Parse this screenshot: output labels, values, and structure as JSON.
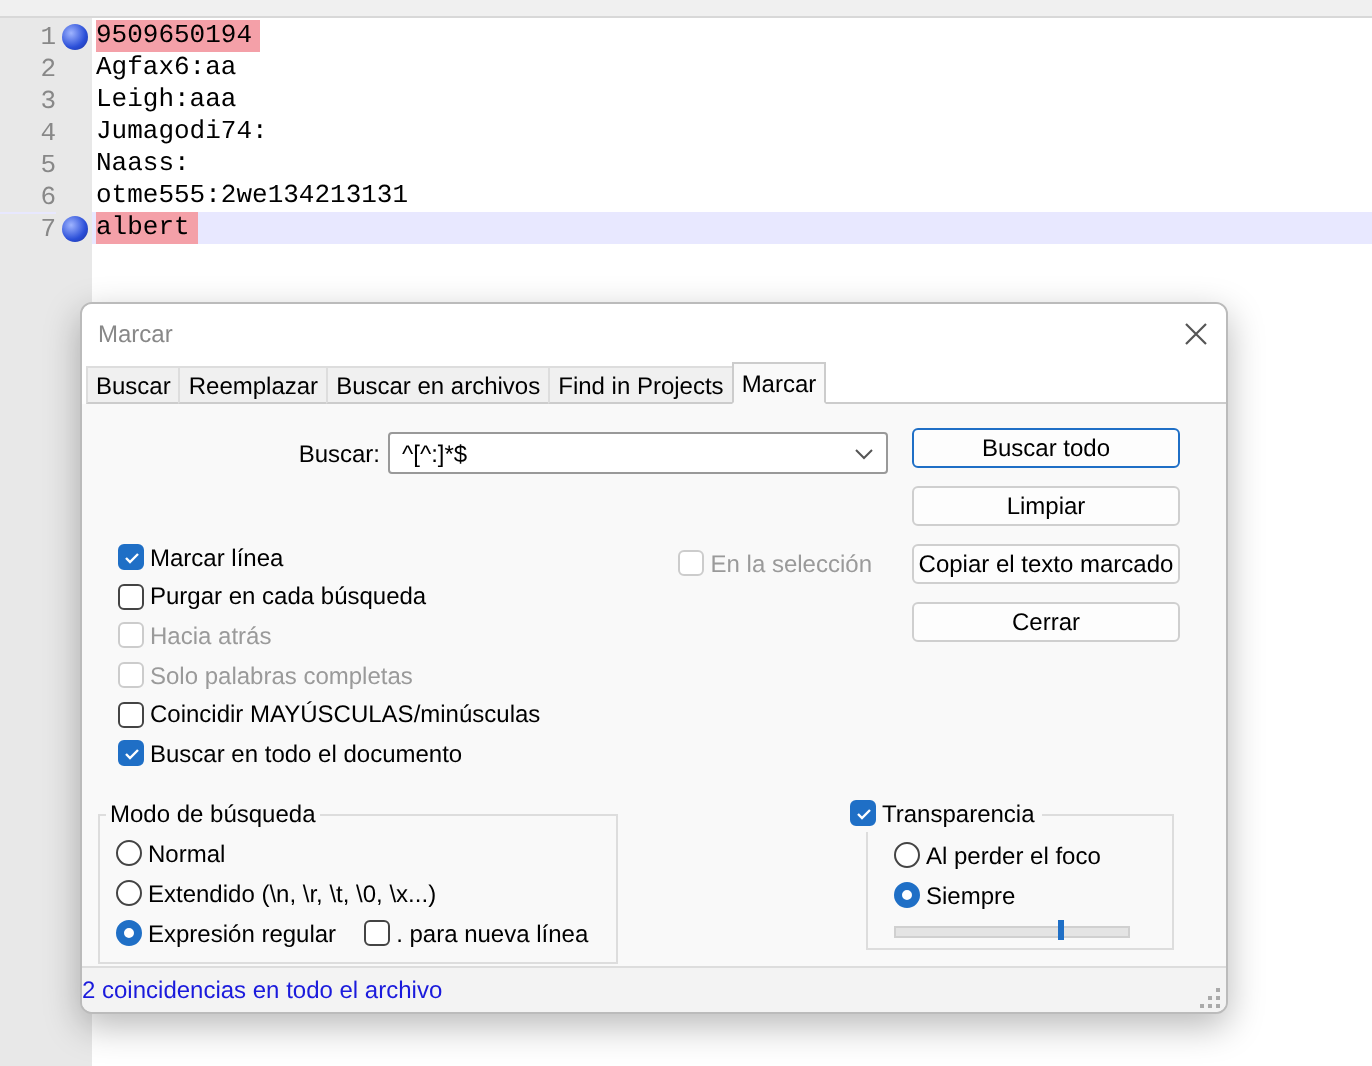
{
  "editor": {
    "lines": [
      {
        "number": "1",
        "text": "9509650194",
        "bookmark": true,
        "marked": true,
        "current": false
      },
      {
        "number": "2",
        "text": "Agfax6:aa",
        "bookmark": false,
        "marked": false,
        "current": false
      },
      {
        "number": "3",
        "text": "Leigh:aaa",
        "bookmark": false,
        "marked": false,
        "current": false
      },
      {
        "number": "4",
        "text": "Jumagodi74:",
        "bookmark": false,
        "marked": false,
        "current": false
      },
      {
        "number": "5",
        "text": "Naass:",
        "bookmark": false,
        "marked": false,
        "current": false
      },
      {
        "number": "6",
        "text": "otme555:2we134213131",
        "bookmark": false,
        "marked": false,
        "current": false
      },
      {
        "number": "7",
        "text": "albert",
        "bookmark": true,
        "marked": true,
        "current": true
      }
    ]
  },
  "dialog": {
    "title": "Marcar",
    "tabs": [
      {
        "label": "Buscar",
        "selected": false
      },
      {
        "label": "Reemplazar",
        "selected": false
      },
      {
        "label": "Buscar en archivos",
        "selected": false
      },
      {
        "label": "Find in Projects",
        "selected": false
      },
      {
        "label": "Marcar",
        "selected": true
      }
    ],
    "search": {
      "label": "Buscar:",
      "value": "^[^:]*$"
    },
    "options": [
      {
        "label": "Marcar línea",
        "checked": true,
        "disabled": false
      },
      {
        "label": "Purgar en cada búsqueda",
        "checked": false,
        "disabled": false
      },
      {
        "label": "Hacia atrás",
        "checked": false,
        "disabled": true
      },
      {
        "label": "Solo palabras completas",
        "checked": false,
        "disabled": true
      },
      {
        "label": "Coincidir MAYÚSCULAS/minúsculas",
        "checked": false,
        "disabled": false
      },
      {
        "label": "Buscar en todo el documento",
        "checked": true,
        "disabled": false
      }
    ],
    "in_selection": {
      "label": "En la selección",
      "checked": false,
      "disabled": true
    },
    "buttons": [
      {
        "label": "Buscar todo",
        "default": true
      },
      {
        "label": "Limpiar",
        "default": false
      },
      {
        "label": "Copiar el texto marcado",
        "default": false
      },
      {
        "label": "Cerrar",
        "default": false
      }
    ],
    "search_mode": {
      "title": "Modo de búsqueda",
      "radios": [
        {
          "label": "Normal",
          "selected": false
        },
        {
          "label": "Extendido (\\n, \\r, \\t, \\0, \\x...)",
          "selected": false
        },
        {
          "label": "Expresión regular",
          "selected": true
        }
      ],
      "newline": {
        "label": ". para nueva línea",
        "checked": false
      }
    },
    "transparency": {
      "label": "Transparencia",
      "checked": true,
      "radios": [
        {
          "label": "Al perder el foco",
          "selected": false
        },
        {
          "label": "Siempre",
          "selected": true
        }
      ],
      "level": 0.7
    },
    "status": "2 coincidencias en todo el archivo"
  }
}
